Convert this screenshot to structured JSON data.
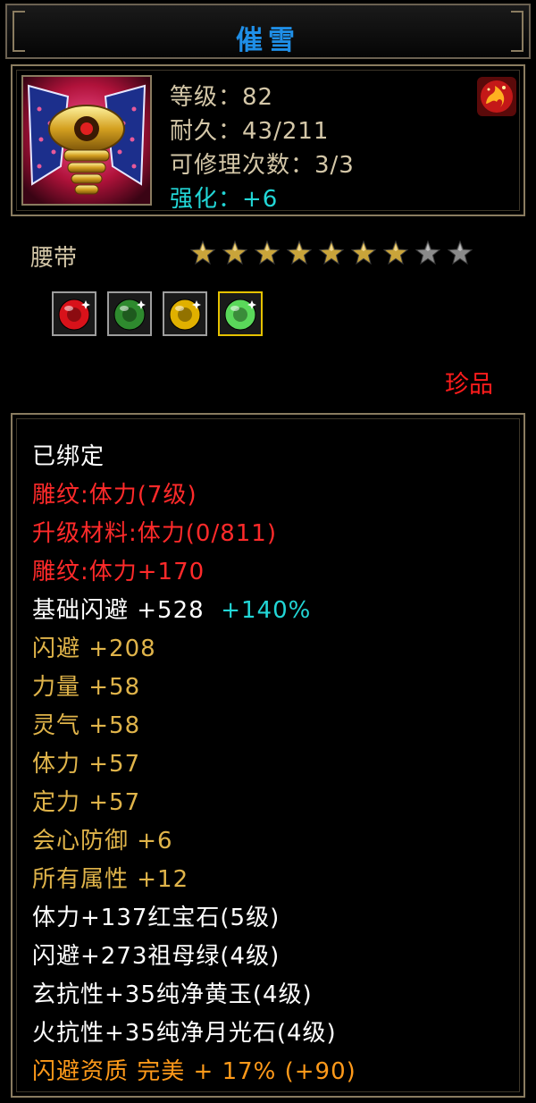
{
  "item": {
    "name": "催雪",
    "level": "等级：82",
    "durability": "耐久：43/211",
    "repairs": "可修理次数：3/3",
    "enhance": "强化：+6",
    "category": "腰带",
    "stars_lit": 7,
    "stars_total": 9,
    "quality": "珍品"
  },
  "gems": [
    {
      "icon": "red-gem-icon",
      "color": "#d8121a"
    },
    {
      "icon": "green-jade-ring-icon",
      "color": "#2e8a2e"
    },
    {
      "icon": "yellow-jade-icon",
      "color": "#e0b000"
    },
    {
      "icon": "moonstone-icon",
      "color": "#5ad85a",
      "selected": true
    }
  ],
  "attributes": {
    "bound": "已绑定",
    "engrave1": "雕纹:体力(7级)",
    "upgrade": "升级材料:体力(0/811)",
    "engrave2": "雕纹:体力+170",
    "base_dodge": "基础闪避 +528",
    "base_dodge_bonus": "+140%",
    "dodge": "闪避 +208",
    "strength": "力量 +58",
    "spirit": "灵气 +58",
    "stamina": "体力 +57",
    "focus": "定力 +57",
    "crit_def": "会心防御 +6",
    "all_attr": "所有属性 +12",
    "gem1": "体力+137红宝石(5级)",
    "gem2": "闪避+273祖母绿(4级)",
    "gem3": "玄抗性+35纯净黄玉(4级)",
    "gem4": "火抗性+35纯净月光石(4级)",
    "aptitude": "闪避资质 完美 + 17% (+90)"
  },
  "colors": {
    "title": "#1f8fe8",
    "label": "#d4c7a8",
    "enhance": "#22d6d6",
    "red": "#ff2a2a",
    "gold": "#e0b44a",
    "aptitude": "#ff9a1a",
    "border": "#8a7c60"
  }
}
